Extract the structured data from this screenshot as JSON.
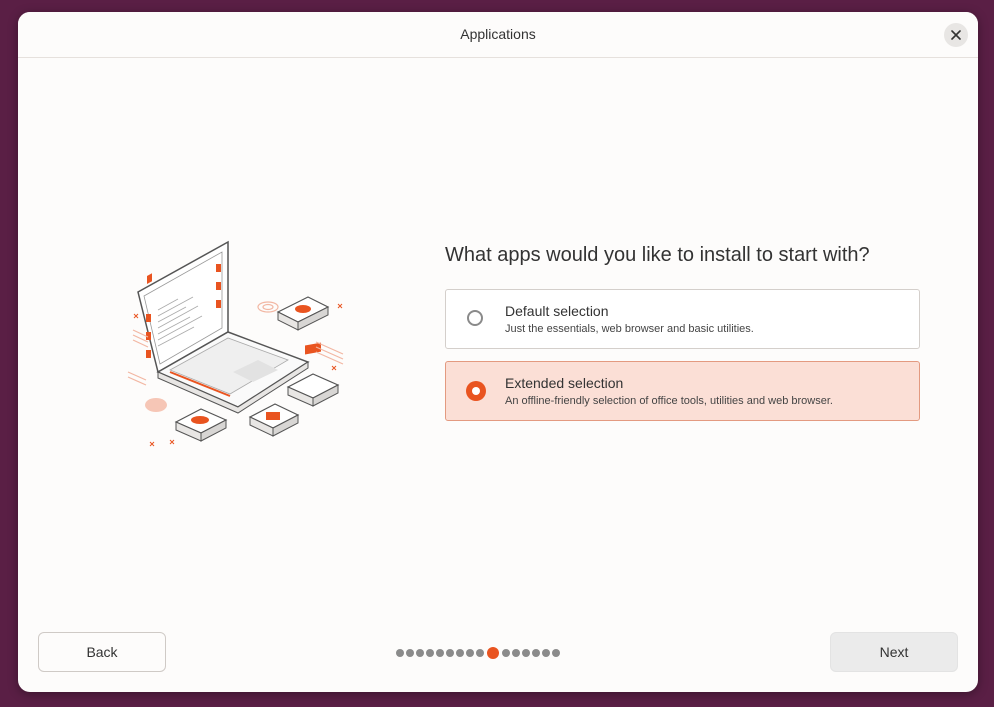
{
  "window": {
    "title": "Applications"
  },
  "icons": {
    "close": "close-icon"
  },
  "main": {
    "question": "What apps would you like to install to start with?",
    "options": [
      {
        "title": "Default selection",
        "description": "Just the essentials, web browser and basic utilities.",
        "selected": false
      },
      {
        "title": "Extended selection",
        "description": "An offline-friendly selection of office tools, utilities and web browser.",
        "selected": true
      }
    ]
  },
  "footer": {
    "back_label": "Back",
    "next_label": "Next",
    "steps_total": 16,
    "current_step": 10
  },
  "colors": {
    "accent": "#e95420",
    "selected_bg": "#fbdfd6",
    "desktop_bg": "#5a1f45"
  }
}
